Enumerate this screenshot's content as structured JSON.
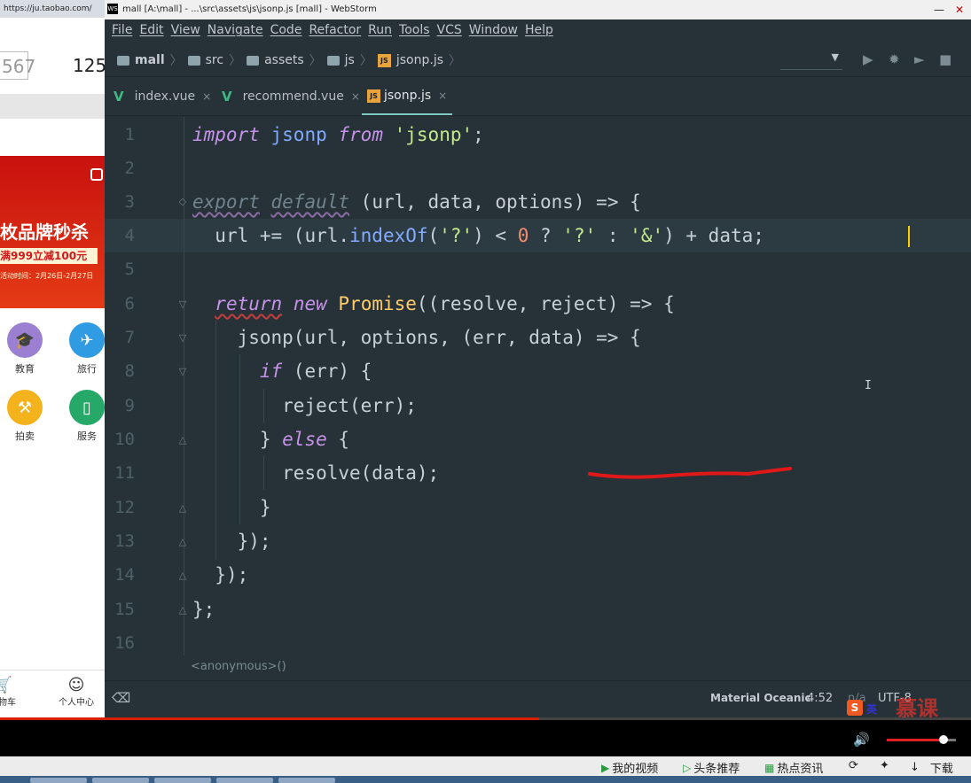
{
  "browser": {
    "tab_url": "https://ju.taobao.com/",
    "field_value": "567",
    "number_text": "125",
    "banner_title": "枚品牌秒杀",
    "banner_sub": "满999立减100元",
    "banner_date": "活动时间：2月26日-2月27日",
    "categories": [
      {
        "label": "教育",
        "icon": "graduation-cap-icon",
        "color": "#9b7fd1"
      },
      {
        "label": "旅行",
        "icon": "plane-icon",
        "color": "#2f9be3"
      },
      {
        "label": "拍卖",
        "icon": "gavel-icon",
        "color": "#f4b21c"
      },
      {
        "label": "服务",
        "icon": "phone-icon",
        "color": "#26a869"
      }
    ],
    "nav": [
      {
        "label": "购物车",
        "icon": "cart-icon"
      },
      {
        "label": "个人中心",
        "icon": "user-icon"
      }
    ]
  },
  "ide": {
    "title": "mall [A:\\mall] - ...\\src\\assets\\js\\jsonp.js [mall] - WebStorm",
    "menu": [
      "File",
      "Edit",
      "View",
      "Navigate",
      "Code",
      "Refactor",
      "Run",
      "Tools",
      "VCS",
      "Window",
      "Help"
    ],
    "breadcrumbs": [
      "mall",
      "src",
      "assets",
      "js",
      "jsonp.js"
    ],
    "tabs": [
      {
        "label": "index.vue",
        "close": "×"
      },
      {
        "label": "recommend.vue",
        "close": "×"
      },
      {
        "label": "jsonp.js",
        "close": "×"
      }
    ],
    "line_numbers": [
      "1",
      "2",
      "3",
      "4",
      "5",
      "6",
      "7",
      "8",
      "9",
      "10",
      "11",
      "12",
      "13",
      "14",
      "15",
      "16"
    ],
    "code": {
      "l1_kw": "import",
      "l1_id": "jsonp",
      "l1_from": "from",
      "l1_str": "'jsonp'",
      "l1_end": ";",
      "l3_export": "export",
      "l3_default": "default",
      "l3_rest": " (url, data, options) => {",
      "l4_a": "url += (url.",
      "l4_fn": "indexOf",
      "l4_b": "(",
      "l4_s1": "'?'",
      "l4_c": ") < ",
      "l4_n": "0",
      "l4_d": " ? ",
      "l4_s2": "'?'",
      "l4_e": " : ",
      "l4_s3": "'&'",
      "l4_f": ") + data;",
      "l6_return": "return",
      "l6_new": "new",
      "l6_cls": "Promise",
      "l6_rest": "((resolve, reject) => {",
      "l7": "jsonp(url, options, (err, data) => {",
      "l8_if": "if",
      "l8_rest": " (err) {",
      "l9": "reject(err);",
      "l10_a": "} ",
      "l10_else": "else",
      "l10_b": " {",
      "l11": "resolve(data);",
      "l12": "}",
      "l13": "});",
      "l14": "});",
      "l15": "};"
    },
    "footer_breadcrumb": "<anonymous>()",
    "status": {
      "theme": "Material Oceanic",
      "position": "4:52",
      "na": "n/a",
      "encoding": "UTF-8"
    }
  },
  "player": {
    "volume_fraction": 0.75
  },
  "footer": [
    {
      "label": "我的视频",
      "icon": "play-icon"
    },
    {
      "label": "头条推荐",
      "icon": "play-circle-icon"
    },
    {
      "label": "热点资讯",
      "icon": "news-icon"
    },
    {
      "label": "下载",
      "icon": "download-icon"
    }
  ],
  "ime": {
    "label": "英"
  },
  "watermark": "慕课"
}
